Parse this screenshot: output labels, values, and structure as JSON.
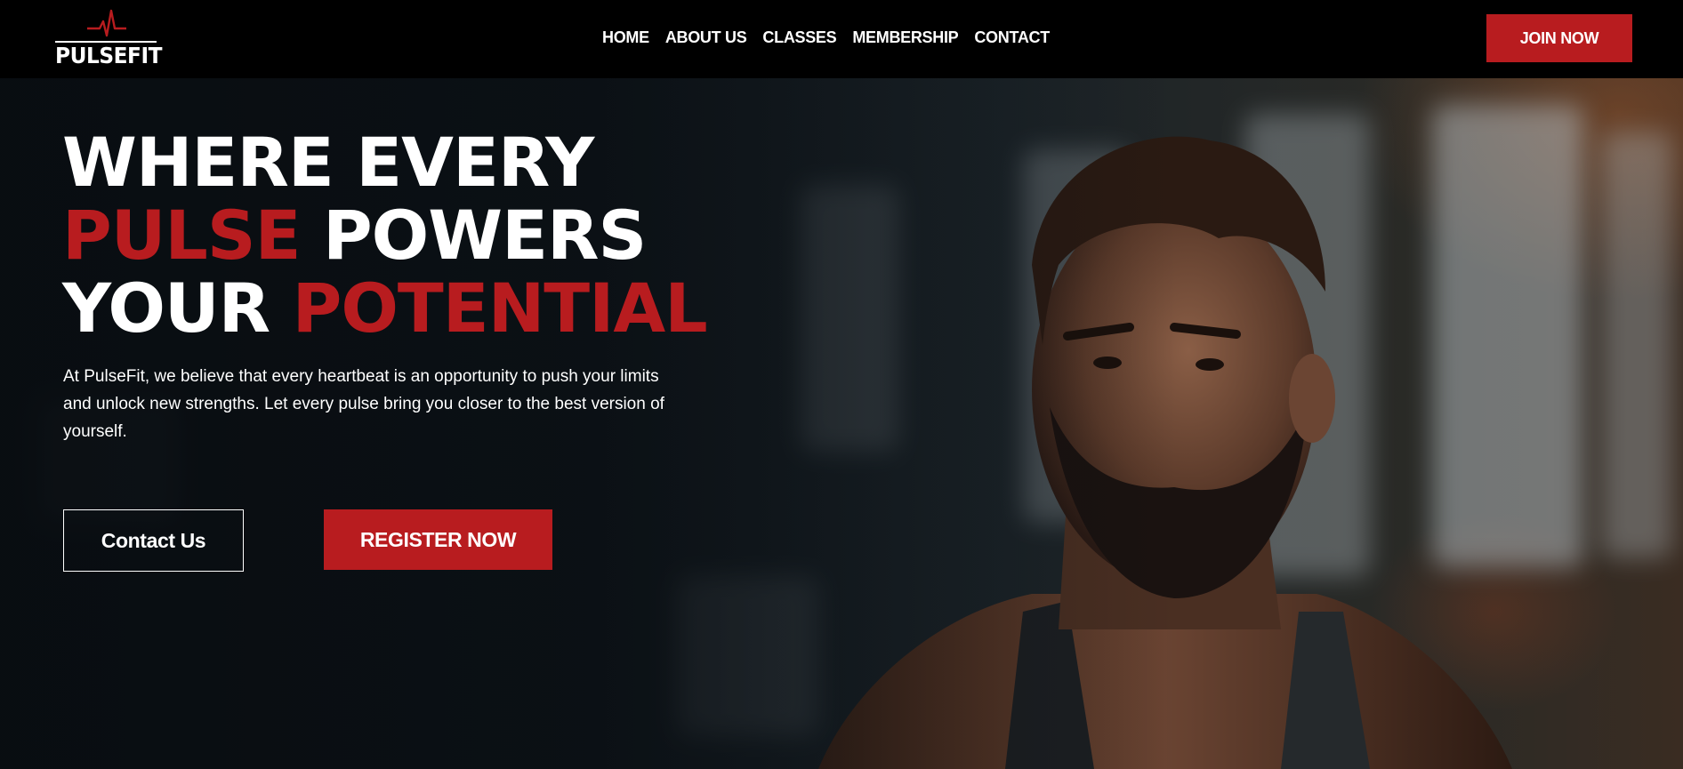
{
  "brand": {
    "name": "PULSEFIT",
    "accent_color": "#b81c1f",
    "logo_icon": "heartbeat-pulse-icon"
  },
  "nav": {
    "items": [
      "HOME",
      "ABOUT US",
      "CLASSES",
      "MEMBERSHIP",
      "CONTACT"
    ],
    "cta_label": "JOIN NOW"
  },
  "hero": {
    "headline": {
      "line1": "WHERE EVERY",
      "line2_accent": "PULSE",
      "line2_rest": " POWERS",
      "line3_start": "YOUR ",
      "line3_accent": "POTENTIAL"
    },
    "description": "At PulseFit, we believe that every heartbeat is an opportunity to push your limits and unlock new strengths. Let every pulse bring you closer to the best version of yourself.",
    "secondary_button": "Contact Us",
    "primary_button": "REGISTER NOW",
    "background_image": "athlete-portrait-photo"
  }
}
